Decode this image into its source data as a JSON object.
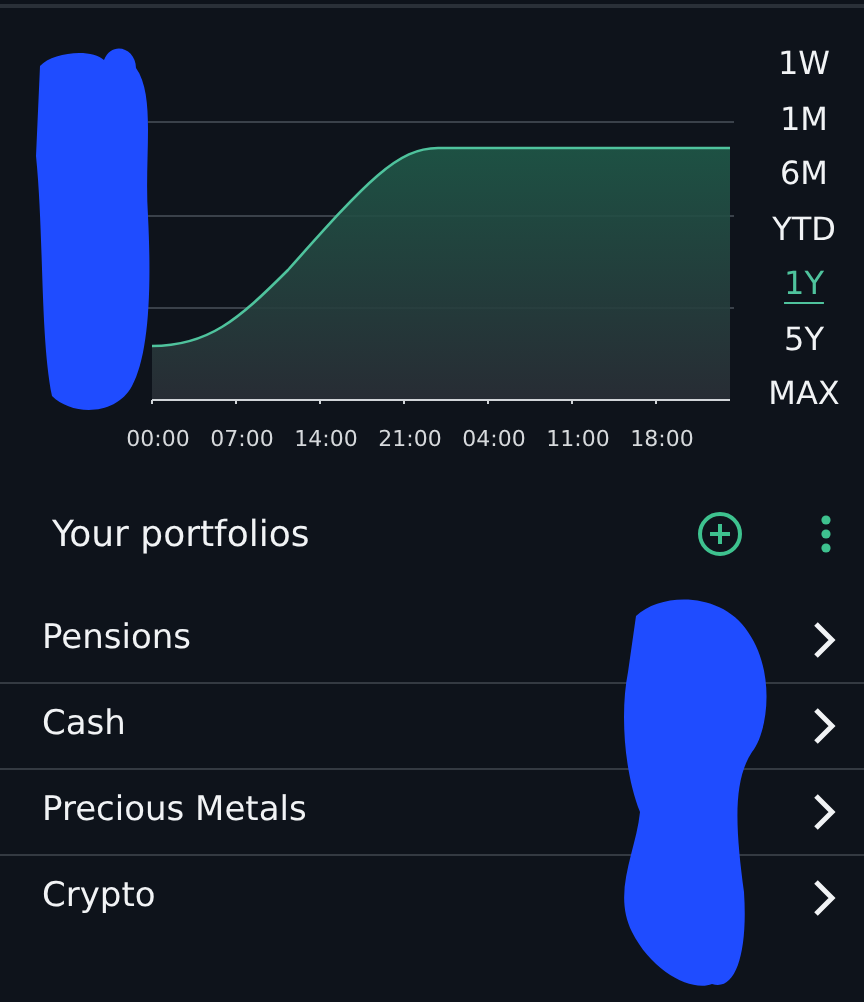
{
  "chart": {
    "x_labels": [
      "00:00",
      "07:00",
      "14:00",
      "21:00",
      "04:00",
      "11:00",
      "18:00"
    ]
  },
  "ranges": [
    {
      "label": "1W",
      "selected": false
    },
    {
      "label": "1M",
      "selected": false
    },
    {
      "label": "6M",
      "selected": false
    },
    {
      "label": "YTD",
      "selected": false
    },
    {
      "label": "1Y",
      "selected": true
    },
    {
      "label": "5Y",
      "selected": false
    },
    {
      "label": "MAX",
      "selected": false
    }
  ],
  "portfolios": {
    "title": "Your portfolios",
    "items": [
      {
        "name": "Pensions"
      },
      {
        "name": "Cash"
      },
      {
        "name": "Precious Metals"
      },
      {
        "name": "Crypto"
      }
    ]
  }
}
